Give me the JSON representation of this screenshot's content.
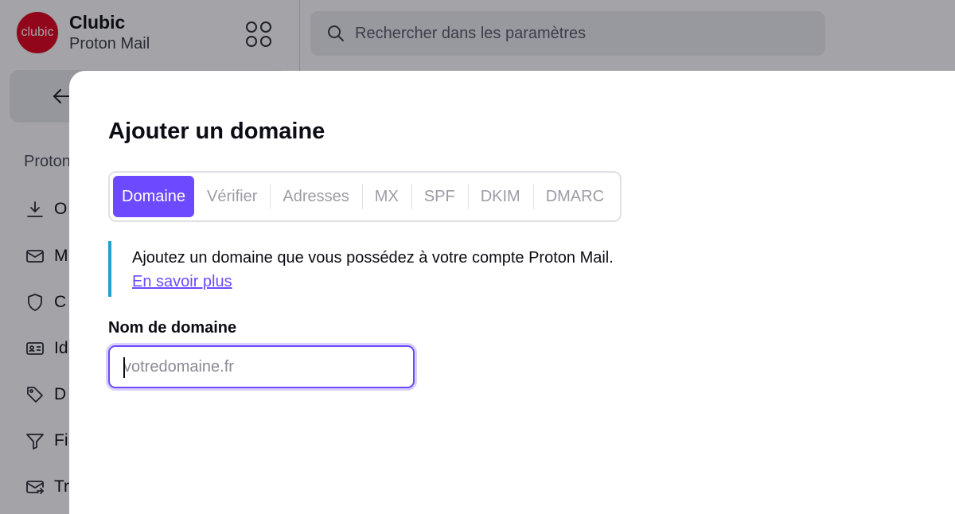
{
  "sidebar": {
    "brand_name": "Clubic",
    "brand_product": "Proton Mail",
    "logo_text": "clubic",
    "section_title": "Proton",
    "items": [
      {
        "icon": "download-icon",
        "label": "O"
      },
      {
        "icon": "envelope-icon",
        "label": "M"
      },
      {
        "icon": "shield-icon",
        "label": "C"
      },
      {
        "icon": "id-card-icon",
        "label": "Id"
      },
      {
        "icon": "tag-icon",
        "label": "D"
      },
      {
        "icon": "filter-icon",
        "label": "Fi"
      },
      {
        "icon": "envelope-arrow-icon",
        "label": "Tr"
      }
    ]
  },
  "search": {
    "placeholder": "Rechercher dans les paramètres"
  },
  "modal": {
    "title": "Ajouter un domaine",
    "steps": [
      "Domaine",
      "Vérifier",
      "Adresses",
      "MX",
      "SPF",
      "DKIM",
      "DMARC"
    ],
    "active_step": "Domaine",
    "info_text": "Ajoutez un domaine que vous possédez à votre compte Proton Mail.",
    "info_link": "En savoir plus",
    "field_label": "Nom de domaine",
    "field_placeholder": "votredomaine.fr",
    "field_value": ""
  },
  "colors": {
    "accent": "#6d4aff",
    "info_border": "#239ece",
    "logo_red": "#e1001a"
  }
}
